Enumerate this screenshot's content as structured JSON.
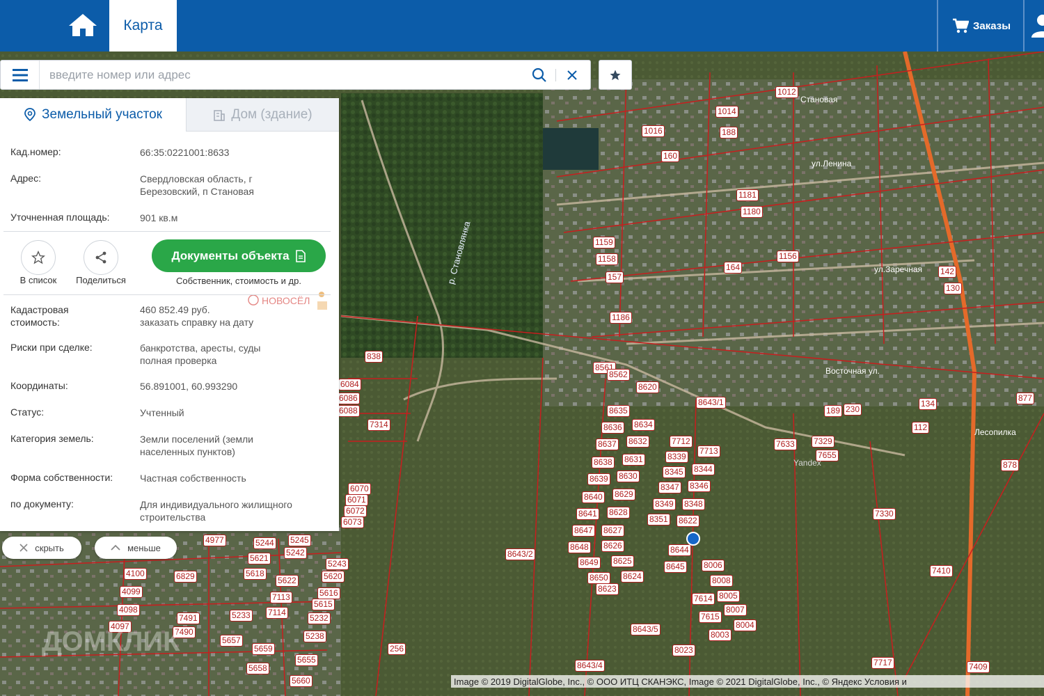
{
  "header": {
    "tab_map": "Карта",
    "orders_label": "Заказы"
  },
  "search": {
    "placeholder": "введите номер или адрес"
  },
  "panel": {
    "tab_land": "Земельный участок",
    "tab_house": "Дом (здание)",
    "rows": {
      "cad_key": "Кад.номер:",
      "cad_val": "66:35:0221001:8633",
      "addr_key": "Адрес:",
      "addr_val": "Свердловская область, г Березовский, п Становая",
      "area_key": "Уточненная площадь:",
      "area_val": "901 кв.м",
      "cost_key": "Кадастровая стоимость:",
      "cost_val": "460 852.49 руб.",
      "cost_link": "заказать справку на дату",
      "risk_key": "Риски при сделке:",
      "risk_val": "банкротства, аресты, суды",
      "risk_link": "полная проверка",
      "coord_key": "Координаты:",
      "coord_val": "56.891001, 60.993290",
      "status_key": "Статус:",
      "status_val": "Учтенный",
      "cat_key": "Категория земель:",
      "cat_val": "Земли поселений (земли населенных пунктов)",
      "own_key": "Форма собственности:",
      "own_val": "Частная собственность",
      "doc_key": "по документу:",
      "doc_val": "Для индивидуального жилищного строительства"
    },
    "actions": {
      "add_list": "В список",
      "share": "Поделиться",
      "docs_button": "Документы объекта",
      "docs_sub": "Собственник, стоимость и др."
    },
    "novosel_label": "НОВОСЁЛ"
  },
  "controls": {
    "hide": "скрыть",
    "less": "меньше"
  },
  "map": {
    "labels": [
      {
        "t": "8643/2"
      },
      {
        "t": "8643/1"
      },
      {
        "t": "8643/5"
      },
      {
        "t": "8643/4"
      },
      {
        "t": "838"
      },
      {
        "t": "7314"
      },
      {
        "t": "256"
      },
      {
        "t": "7330"
      },
      {
        "t": "7410"
      },
      {
        "t": "7409"
      },
      {
        "t": "7633"
      },
      {
        "t": "7329"
      },
      {
        "t": "7655"
      },
      {
        "t": "8635"
      },
      {
        "t": "8634"
      },
      {
        "t": "8636"
      },
      {
        "t": "8632"
      },
      {
        "t": "8637"
      },
      {
        "t": "8631"
      },
      {
        "t": "8638"
      },
      {
        "t": "8630"
      },
      {
        "t": "8639"
      },
      {
        "t": "8629"
      },
      {
        "t": "8640"
      },
      {
        "t": "8628"
      },
      {
        "t": "8641"
      },
      {
        "t": "8627"
      },
      {
        "t": "8647"
      },
      {
        "t": "8626"
      },
      {
        "t": "8648"
      },
      {
        "t": "8625"
      },
      {
        "t": "8649"
      },
      {
        "t": "8624"
      },
      {
        "t": "8650"
      },
      {
        "t": "8623"
      },
      {
        "t": "7712"
      },
      {
        "t": "7713"
      },
      {
        "t": "8339"
      },
      {
        "t": "8344"
      },
      {
        "t": "8345"
      },
      {
        "t": "8346"
      },
      {
        "t": "8347"
      },
      {
        "t": "8348"
      },
      {
        "t": "8349"
      },
      {
        "t": "8622"
      },
      {
        "t": "8351"
      },
      {
        "t": "8644"
      },
      {
        "t": "8645"
      },
      {
        "t": "8620"
      },
      {
        "t": "8561"
      },
      {
        "t": "8562"
      },
      {
        "t": "1012"
      },
      {
        "t": "1016"
      },
      {
        "t": "1014"
      },
      {
        "t": "188"
      },
      {
        "t": "160"
      },
      {
        "t": "1181"
      },
      {
        "t": "1180"
      },
      {
        "t": "1159"
      },
      {
        "t": "1158"
      },
      {
        "t": "157"
      },
      {
        "t": "164"
      },
      {
        "t": "1156"
      },
      {
        "t": "130"
      },
      {
        "t": "142"
      },
      {
        "t": "877"
      },
      {
        "t": "878"
      },
      {
        "t": "134"
      },
      {
        "t": "189"
      },
      {
        "t": "230"
      },
      {
        "t": "6084"
      },
      {
        "t": "6086"
      },
      {
        "t": "6088"
      },
      {
        "t": "6070"
      },
      {
        "t": "6071"
      },
      {
        "t": "6072"
      },
      {
        "t": "6073"
      },
      {
        "t": "4977"
      },
      {
        "t": "5244"
      },
      {
        "t": "5245"
      },
      {
        "t": "5242"
      },
      {
        "t": "5243"
      },
      {
        "t": "5621"
      },
      {
        "t": "5618"
      },
      {
        "t": "5622"
      },
      {
        "t": "5620"
      },
      {
        "t": "5616"
      },
      {
        "t": "5615"
      },
      {
        "t": "5233"
      },
      {
        "t": "5232"
      },
      {
        "t": "5238"
      },
      {
        "t": "5657"
      },
      {
        "t": "5659"
      },
      {
        "t": "5658"
      },
      {
        "t": "5655"
      },
      {
        "t": "5660"
      },
      {
        "t": "4100"
      },
      {
        "t": "4099"
      },
      {
        "t": "4098"
      },
      {
        "t": "4097"
      },
      {
        "t": "6829"
      },
      {
        "t": "7113"
      },
      {
        "t": "7114"
      },
      {
        "t": "7491"
      },
      {
        "t": "7490"
      },
      {
        "t": "1186"
      },
      {
        "t": "112"
      },
      {
        "t": "7717"
      },
      {
        "t": "8004"
      },
      {
        "t": "8003"
      },
      {
        "t": "8007"
      },
      {
        "t": "8005"
      },
      {
        "t": "8008"
      },
      {
        "t": "8006"
      },
      {
        "t": "7615"
      },
      {
        "t": "7614"
      },
      {
        "t": "8023"
      }
    ],
    "streets": [
      "Становая",
      "ул.Ленина",
      "Восточная ул.",
      "ул.Заречная"
    ],
    "river": "р. Становлянка",
    "village": "Лесопилка",
    "yandex": "Yandex"
  },
  "attribution": "Image © 2019 DigitalGlobe, Inc., © ООО ИТЦ СКАНЭКС, Image © 2021 DigitalGlobe, Inc., © Яндекс Условия и",
  "watermark": "ДОМКЛИК"
}
